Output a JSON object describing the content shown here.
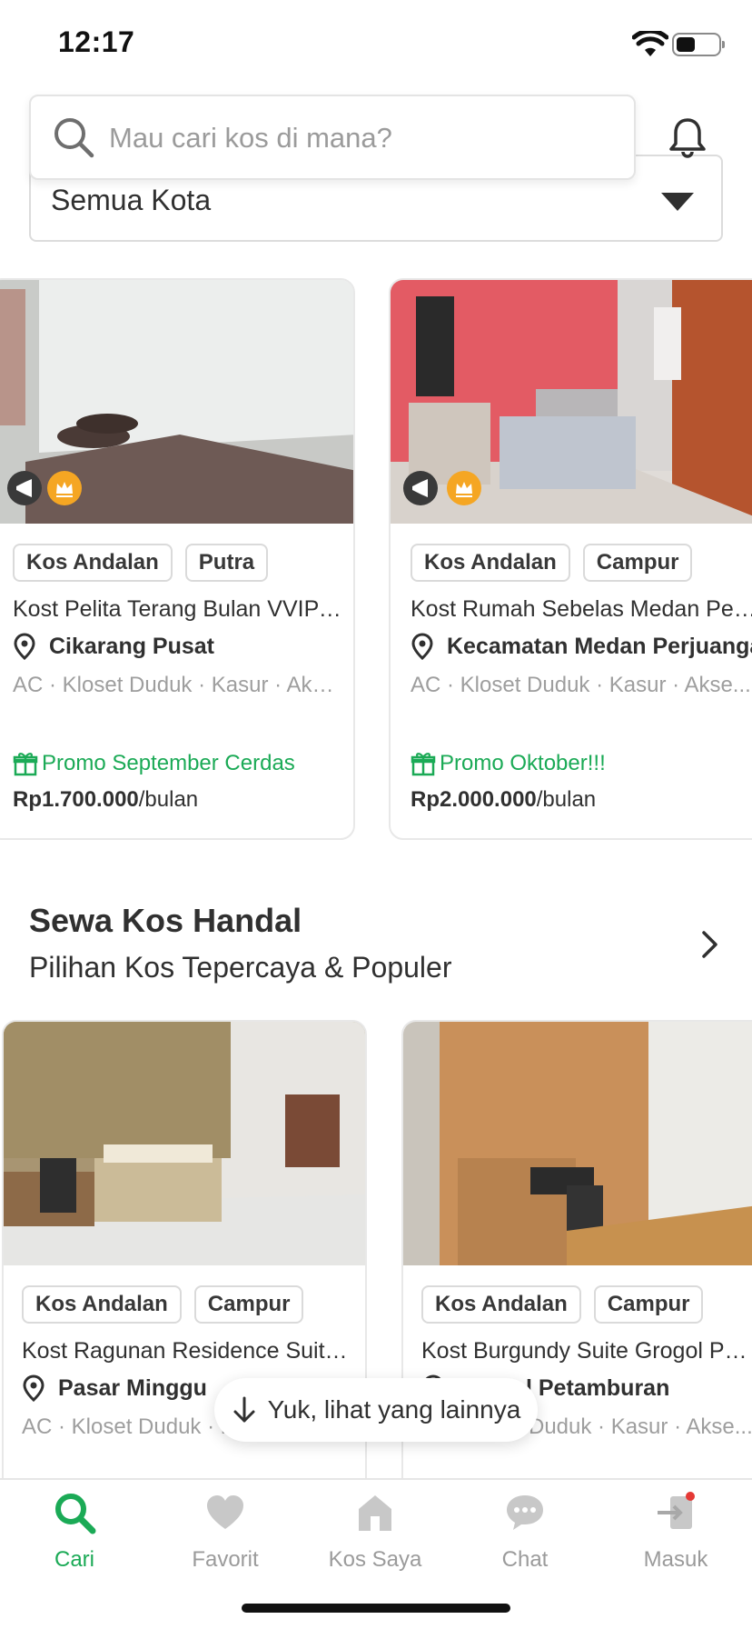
{
  "status_bar": {
    "time": "12:17"
  },
  "search": {
    "placeholder": "Mau cari kos di mana?"
  },
  "city_filter": {
    "selected": "Semua Kota"
  },
  "featured_listings": [
    {
      "tags": [
        "Kos Andalan",
        "Putra"
      ],
      "name": "Kost Pelita Terang Bulan VVIP C...",
      "location": "Cikarang Pusat",
      "facilities": "AC · Kloset Duduk · Kasur · Akse...",
      "promo": "Promo September Cerdas",
      "price": "Rp1.700.000",
      "period": "/bulan"
    },
    {
      "tags": [
        "Kos Andalan",
        "Campur"
      ],
      "name": "Kost Rumah Sebelas Medan Perj...",
      "location": "Kecamatan Medan Perjuanga",
      "facilities": "AC · Kloset Duduk · Kasur · Akse...",
      "promo": "Promo Oktober!!!",
      "price": "Rp2.000.000",
      "period": "/bulan"
    }
  ],
  "section": {
    "title": "Sewa Kos Handal",
    "subtitle": "Pilihan Kos Tepercaya & Populer"
  },
  "handal_listings": [
    {
      "tags": [
        "Kos Andalan",
        "Campur"
      ],
      "name": "Kost Ragunan Residence Suites...",
      "location": "Pasar Minggu",
      "facilities": "AC · Kloset Duduk · K"
    },
    {
      "tags": [
        "Kos Andalan",
        "Campur"
      ],
      "name": "Kost Burgundy Suite Grogol Pet...",
      "location": "Grogol Petamburan",
      "facilities": "Duduk · Kasur · Akse..."
    }
  ],
  "more_button": {
    "label": "Yuk, lihat yang lainnya"
  },
  "bottom_nav": [
    {
      "label": "Cari",
      "icon": "search-icon",
      "active": true
    },
    {
      "label": "Favorit",
      "icon": "heart-icon",
      "active": false
    },
    {
      "label": "Kos Saya",
      "icon": "home-icon",
      "active": false
    },
    {
      "label": "Chat",
      "icon": "chat-icon",
      "active": false
    },
    {
      "label": "Masuk",
      "icon": "login-icon",
      "active": false
    }
  ],
  "colors": {
    "accent": "#1baa56",
    "badge_gold": "#f5a623",
    "notification_dot": "#e53935"
  }
}
